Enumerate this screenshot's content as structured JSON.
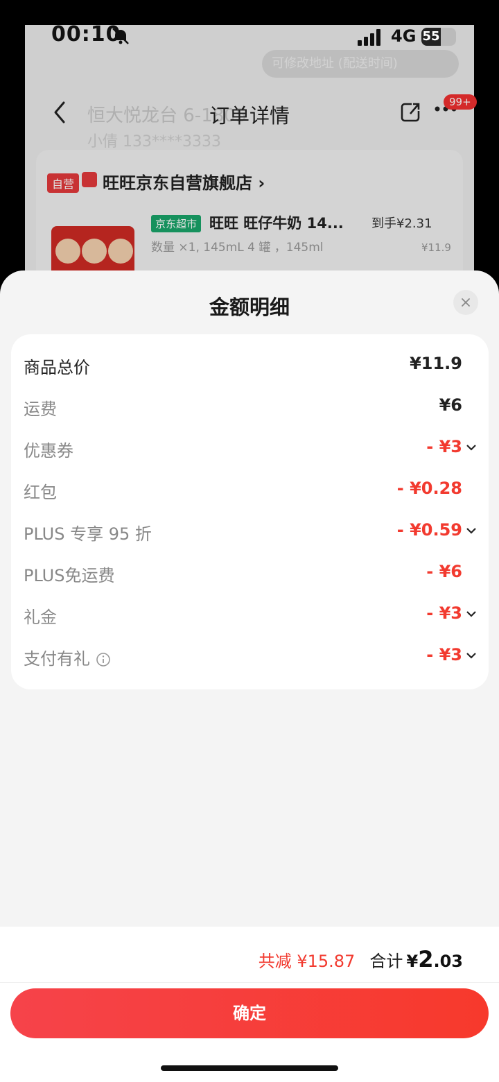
{
  "status": {
    "time": "00:10",
    "network": "4G",
    "battery": "55"
  },
  "background_page": {
    "nav_title": "订单详情",
    "badge": "99+",
    "address": "恒大悦龙台 6-1805",
    "address_sub": "小倩 133****3333",
    "tip": "可修改地址 (配送时间)",
    "store": {
      "tag": "自营",
      "name": "旺旺京东自营旗舰店 ›",
      "product_tag": "京东超市",
      "product_title": "旺旺 旺仔牛奶 14...",
      "product_spec": "数量 ×1, 145mL 4 罐 ，145ml",
      "price_label": "到手¥2.31",
      "price_orig": "¥11.9"
    }
  },
  "sheet": {
    "title": "金额明细",
    "rows": [
      {
        "label": "商品总价",
        "value": "¥11.9"
      },
      {
        "label": "运费",
        "value": "¥6"
      },
      {
        "label": "优惠券",
        "value": "- ¥3"
      },
      {
        "label": "红包",
        "value": "- ¥0.28"
      },
      {
        "label": "PLUS 专享 95 折",
        "value": "- ¥0.59"
      },
      {
        "label": "PLUS免运费",
        "value": "- ¥6"
      },
      {
        "label": "礼金",
        "value": "- ¥3"
      },
      {
        "label": "支付有礼",
        "value": "- ¥3"
      }
    ]
  },
  "footer": {
    "reduce_text": "共减 ¥15.87",
    "total_label": "合计",
    "total_yen": "¥",
    "total_int": "2",
    "total_dec": ".03",
    "confirm_label": "确定"
  },
  "colors": {
    "accent_red": "#f23a2f",
    "button_red": "#f6434a"
  }
}
